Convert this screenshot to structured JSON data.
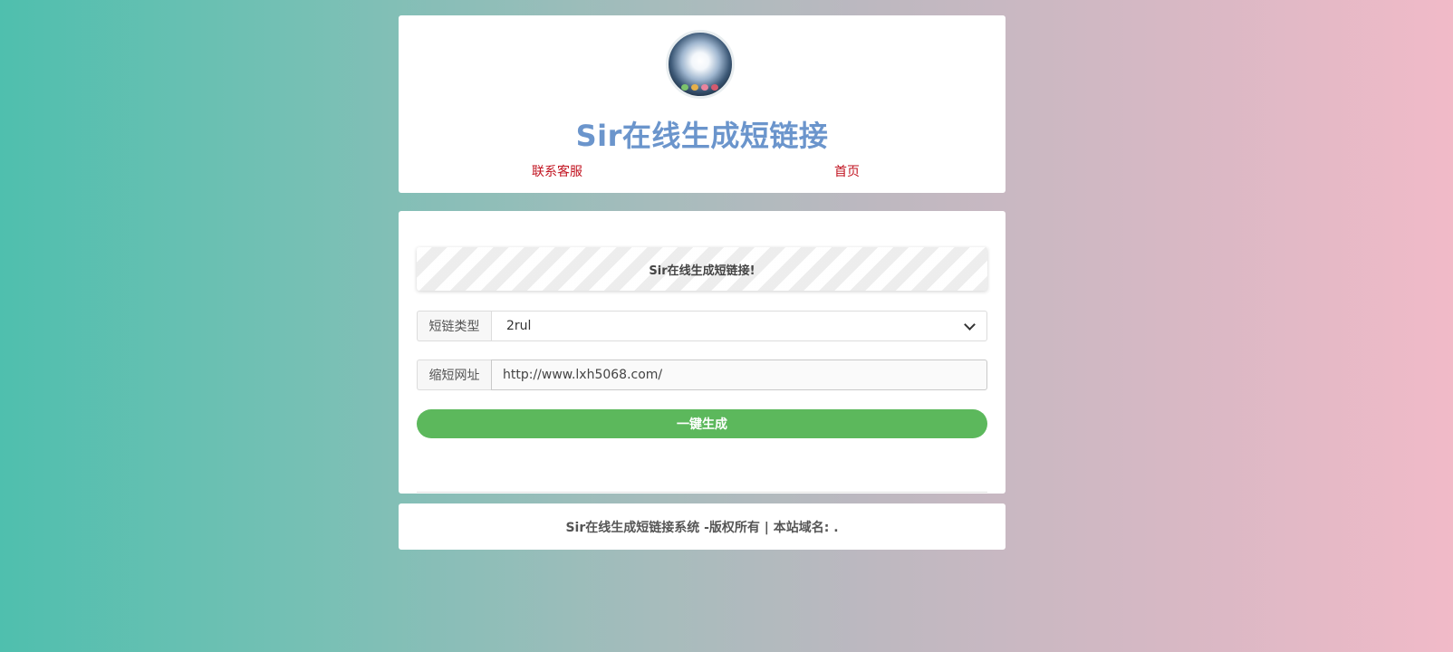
{
  "header": {
    "title": "Sir在线生成短链接",
    "nav": {
      "contact_label": "联系客服",
      "home_label": "首页"
    },
    "avatar": {
      "icon": "avatar-image"
    },
    "colors": {
      "title": "#6b95cc",
      "link": "#c1121f"
    }
  },
  "main": {
    "notice": "Sir在线生成短链接!",
    "form": {
      "type_label": "短链类型",
      "type_selected": "2rul",
      "url_label": "缩短网址",
      "url_value": "http://www.lxh5068.com/"
    },
    "generate_label": "一键生成",
    "colors": {
      "button": "#5cb85c"
    }
  },
  "footer": {
    "text": "Sir在线生成短链接系统 -版权所有 | 本站域名: ."
  }
}
